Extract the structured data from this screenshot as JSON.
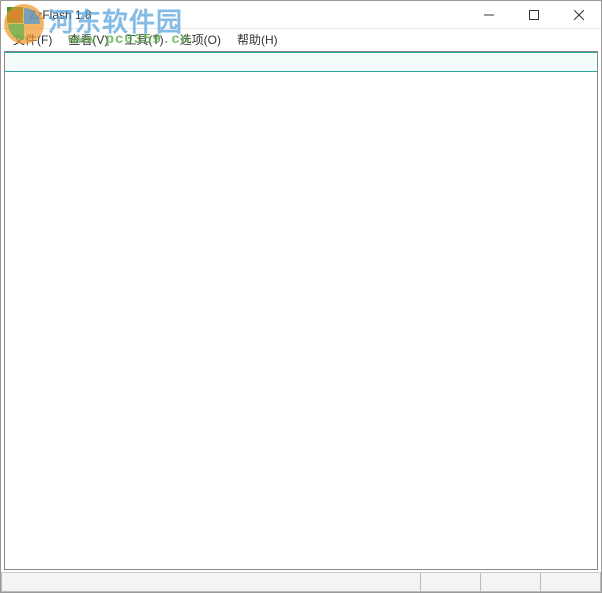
{
  "window": {
    "title": "ZzFlash 1.8"
  },
  "menu": {
    "file": "文件(F)",
    "view": "查看(V)",
    "tools": "工具(T)",
    "options": "选项(O)",
    "help": "帮助(H)"
  },
  "watermark": {
    "site_name": "河东软件园",
    "url": "www.pc0359.cn"
  }
}
